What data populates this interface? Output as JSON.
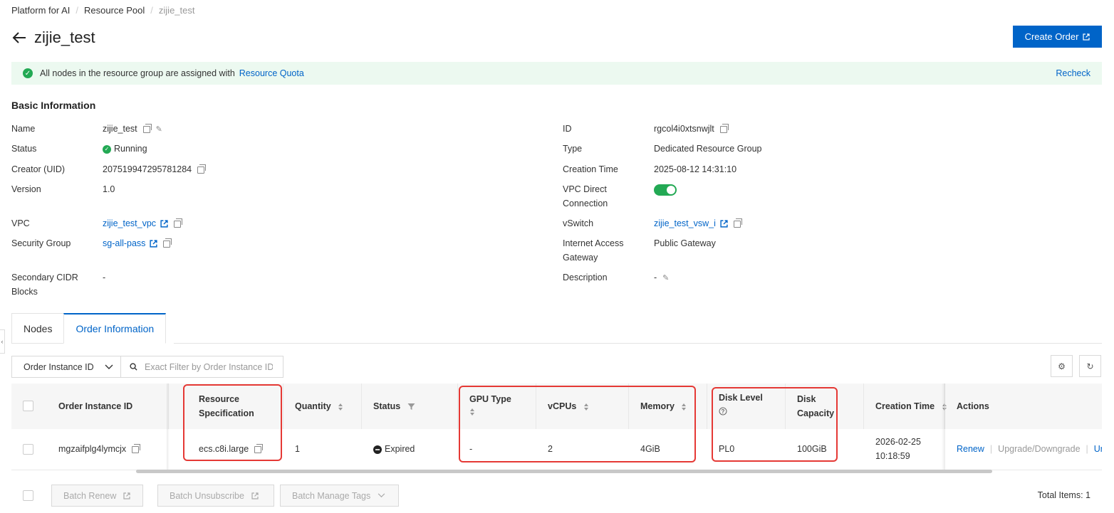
{
  "breadcrumb": {
    "items": [
      "Platform for AI",
      "Resource Pool"
    ],
    "current": "zijie_test"
  },
  "header": {
    "title": "zijie_test",
    "create_order_label": "Create Order"
  },
  "notice": {
    "text": "All nodes in the resource group are assigned with",
    "link": "Resource Quota",
    "recheck": "Recheck"
  },
  "basic_info": {
    "title": "Basic Information",
    "name_label": "Name",
    "name_value": "zijie_test",
    "status_label": "Status",
    "status_value": "Running",
    "creator_label": "Creator (UID)",
    "creator_value": "207519947295781284",
    "version_label": "Version",
    "version_value": "1.0",
    "vpc_label": "VPC",
    "vpc_value": "zijie_test_vpc",
    "security_group_label": "Security Group",
    "security_group_value": "sg-all-pass",
    "cidr_label_1": "Secondary CIDR",
    "cidr_label_2": "Blocks",
    "cidr_value": "-",
    "id_label": "ID",
    "id_value": "rgcol4i0xtsnwjlt",
    "type_label": "Type",
    "type_value": "Dedicated Resource Group",
    "creation_time_label": "Creation Time",
    "creation_time_value": "2025-08-12 14:31:10",
    "vpc_direct_label_1": "VPC Direct",
    "vpc_direct_label_2": "Connection",
    "vpc_direct_enabled": true,
    "vswitch_label": "vSwitch",
    "vswitch_value": "zijie_test_vsw_i",
    "internet_label_1": "Internet Access",
    "internet_label_2": "Gateway",
    "internet_value": "Public Gateway",
    "description_label": "Description",
    "description_value": "-"
  },
  "tabs": [
    "Nodes",
    "Order Information"
  ],
  "filter": {
    "select_value": "Order Instance ID",
    "placeholder": "Exact Filter by Order Instance ID"
  },
  "table": {
    "columns": {
      "order_id": "Order Instance ID",
      "spec_1": "Resource",
      "spec_2": "Specification",
      "quantity": "Quantity",
      "status": "Status",
      "gpu": "GPU Type",
      "vcpus": "vCPUs",
      "memory": "Memory",
      "disk_level": "Disk Level",
      "disk_cap_1": "Disk",
      "disk_cap_2": "Capacity",
      "creation_time": "Creation Time",
      "actions": "Actions"
    },
    "rows": [
      {
        "order_id": "mgzaifplg4lymcjx",
        "spec": "ecs.c8i.large",
        "quantity": "1",
        "status": "Expired",
        "gpu": "-",
        "vcpus": "2",
        "memory": "4GiB",
        "disk_level": "PL0",
        "disk_capacity": "100GiB",
        "creation_date": "2026-02-25",
        "creation_clock": "10:18:59",
        "action_renew": "Renew",
        "action_upgrade": "Upgrade/Downgrade",
        "action_unsubscribe": "Un"
      }
    ]
  },
  "footer": {
    "batch_renew": "Batch Renew",
    "batch_unsubscribe": "Batch Unsubscribe",
    "batch_tags": "Batch Manage Tags",
    "total": "Total Items: 1"
  },
  "colors": {
    "primary": "#0064c8",
    "success": "#23a954",
    "highlight": "#e53935",
    "notice_bg": "#ecf9f0"
  },
  "icons": [
    "back-arrow-icon",
    "external-link-icon",
    "check-circle-icon",
    "copy-icon",
    "pencil-icon",
    "search-icon",
    "chevron-down-icon",
    "gear-icon",
    "refresh-icon",
    "sort-icon",
    "filter-icon",
    "help-icon",
    "expired-icon"
  ]
}
